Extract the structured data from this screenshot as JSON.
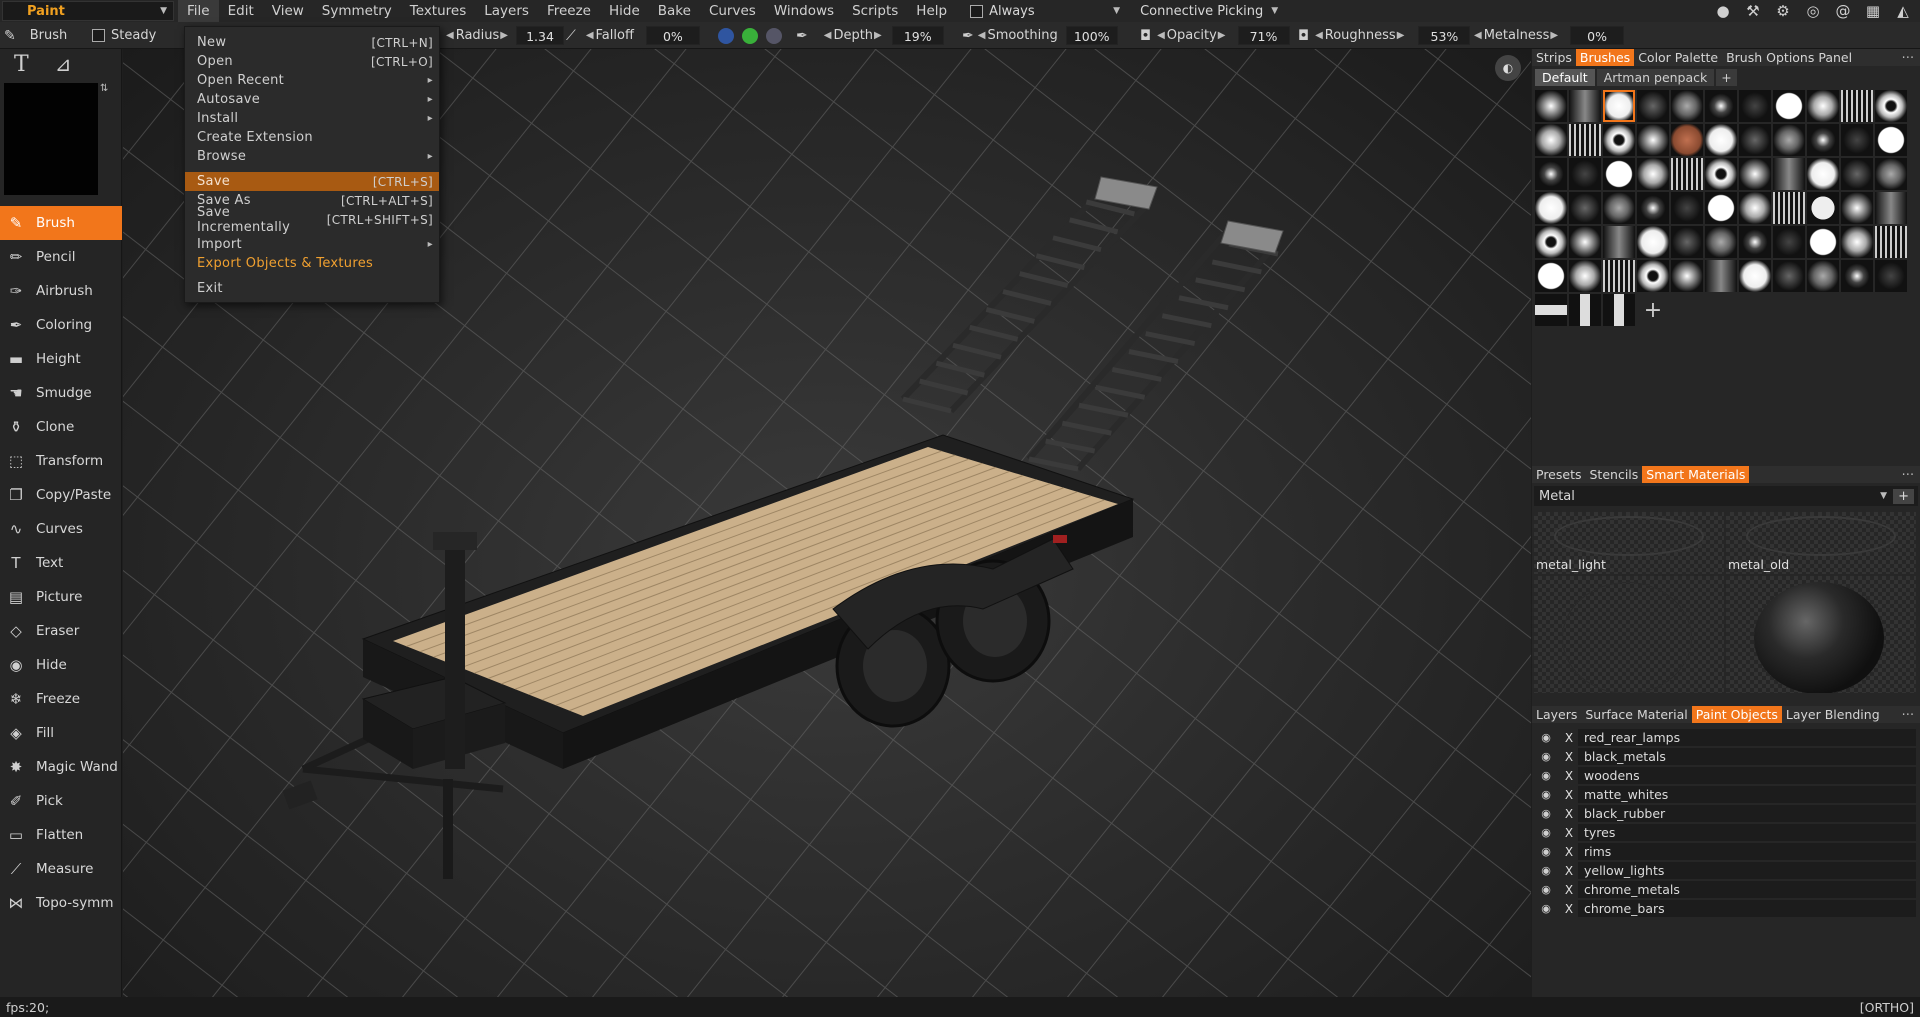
{
  "menubar": {
    "room": "Paint",
    "items": [
      "File",
      "Edit",
      "View",
      "Symmetry",
      "Textures",
      "Layers",
      "Freeze",
      "Hide",
      "Bake",
      "Curves",
      "Windows",
      "Scripts",
      "Help"
    ],
    "always_label": "Always",
    "connective_label": "Connective Picking"
  },
  "toolbar": {
    "tool_label": "Brush",
    "steady_label": "Steady",
    "radius_label": "Radius",
    "radius_value": "1.34",
    "falloff_label": "Falloff",
    "falloff_value": "0%",
    "depth_label": "Depth",
    "depth_value": "19%",
    "smoothing_label": "Smoothing",
    "smoothing_value": "100%",
    "opacity_label": "Opacity",
    "opacity_value": "71%",
    "roughness_label": "Roughness",
    "roughness_value": "53%",
    "metalness_label": "Metalness",
    "metalness_value": "0%"
  },
  "tools": [
    {
      "label": "Brush",
      "icon": "brush-icon",
      "glyph": "✎"
    },
    {
      "label": "Pencil",
      "icon": "pencil-icon",
      "glyph": "✏"
    },
    {
      "label": "Airbrush",
      "icon": "airbrush-icon",
      "glyph": "✑"
    },
    {
      "label": "Coloring",
      "icon": "coloring-icon",
      "glyph": "✒"
    },
    {
      "label": "Height",
      "icon": "height-icon",
      "glyph": "▬"
    },
    {
      "label": "Smudge",
      "icon": "smudge-icon",
      "glyph": "☚"
    },
    {
      "label": "Clone",
      "icon": "clone-icon",
      "glyph": "⚱"
    },
    {
      "label": "Transform",
      "icon": "transform-icon",
      "glyph": "⬚"
    },
    {
      "label": "Copy/Paste",
      "icon": "copy-paste-icon",
      "glyph": "❐"
    },
    {
      "label": "Curves",
      "icon": "curves-icon",
      "glyph": "∿"
    },
    {
      "label": "Text",
      "icon": "text-icon",
      "glyph": "T"
    },
    {
      "label": "Picture",
      "icon": "picture-icon",
      "glyph": "▤"
    },
    {
      "label": "Eraser",
      "icon": "eraser-icon",
      "glyph": "◇"
    },
    {
      "label": "Hide",
      "icon": "eye-icon",
      "glyph": "◉"
    },
    {
      "label": "Freeze",
      "icon": "snowflake-icon",
      "glyph": "❄"
    },
    {
      "label": "Fill",
      "icon": "fill-bucket-icon",
      "glyph": "◈"
    },
    {
      "label": "Magic Wand",
      "icon": "magic-wand-icon",
      "glyph": "✸"
    },
    {
      "label": "Pick",
      "icon": "pipette-icon",
      "glyph": "✐"
    },
    {
      "label": "Flatten",
      "icon": "flatten-icon",
      "glyph": "▭"
    },
    {
      "label": "Measure",
      "icon": "ruler-icon",
      "glyph": "⟋"
    },
    {
      "label": "Topo-symm",
      "icon": "butterfly-icon",
      "glyph": "⋈"
    }
  ],
  "file_menu": {
    "items": [
      {
        "label": "New",
        "shortcut": "[CTRL+N]"
      },
      {
        "label": "Open",
        "shortcut": "[CTRL+O]"
      },
      {
        "label": "Open Recent",
        "submenu": "▸"
      },
      {
        "label": "Autosave",
        "submenu": "▸"
      },
      {
        "label": "Install",
        "submenu": "▸"
      },
      {
        "label": "Create Extension"
      },
      {
        "label": "Browse",
        "submenu": "▸"
      },
      {
        "label": "Save",
        "shortcut": "[CTRL+S]"
      },
      {
        "label": "Save As",
        "shortcut": "[CTRL+ALT+S]"
      },
      {
        "label": "Save Incrementally",
        "shortcut": "[CTRL+SHIFT+S]"
      },
      {
        "label": "Import",
        "submenu": "▸"
      },
      {
        "label": "Export Objects & Textures"
      },
      {
        "label": "Exit"
      }
    ]
  },
  "brushes_panel": {
    "tabs": [
      "Strips",
      "Brushes",
      "Color Palette",
      "Brush Options Panel"
    ],
    "subtabs": [
      "Default",
      "Artman penpack",
      "+"
    ]
  },
  "smart_materials_panel": {
    "tabs": [
      "Presets",
      "Stencils",
      "Smart Materials"
    ],
    "category": "Metal",
    "materials": [
      "metal_light",
      "metal_old",
      "",
      ""
    ]
  },
  "paint_objects_panel": {
    "tabs": [
      "Layers",
      "Surface Material",
      "Paint Objects",
      "Layer Blending"
    ],
    "objects": [
      "red_rear_lamps",
      "black_metals",
      "woodens",
      "matte_whites",
      "black_rubber",
      "tyres",
      "rims",
      "yellow_lights",
      "chrome_metals",
      "chrome_bars"
    ]
  },
  "statusbar": {
    "fps": "fps:20;",
    "mode": "[ORTHO]"
  },
  "colors": {
    "accent": "#f2761b",
    "menu_highlight": "#a85a12",
    "room_text": "#f0a020"
  }
}
